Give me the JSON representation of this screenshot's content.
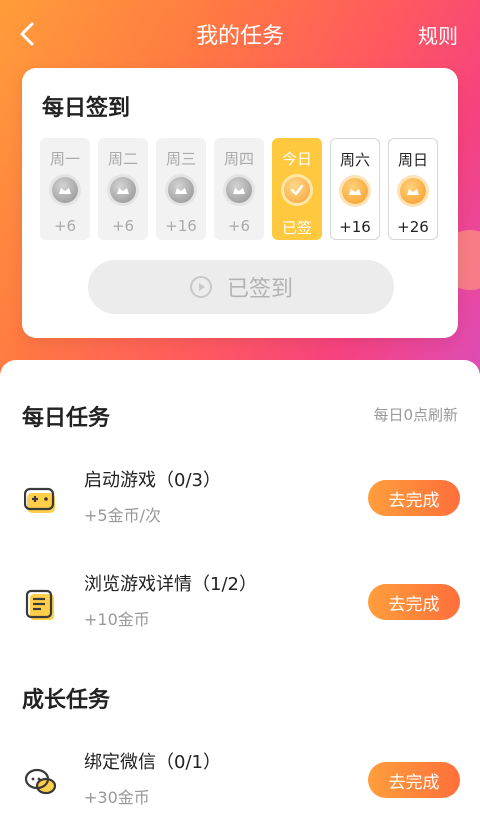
{
  "header": {
    "title": "我的任务",
    "rules_label": "规则"
  },
  "signin": {
    "title": "每日签到",
    "days": [
      {
        "label": "周一",
        "reward": "+6",
        "state": "past"
      },
      {
        "label": "周二",
        "reward": "+6",
        "state": "past"
      },
      {
        "label": "周三",
        "reward": "+16",
        "state": "past"
      },
      {
        "label": "周四",
        "reward": "+6",
        "state": "past"
      },
      {
        "label": "今日",
        "reward": "已签",
        "state": "today"
      },
      {
        "label": "周六",
        "reward": "+16",
        "state": "future"
      },
      {
        "label": "周日",
        "reward": "+26",
        "state": "future"
      }
    ],
    "button_label": "已签到"
  },
  "daily_tasks": {
    "title": "每日任务",
    "refresh_note": "每日0点刷新",
    "items": [
      {
        "name": "启动游戏（0/3）",
        "reward": "+5金币/次",
        "button": "去完成",
        "icon": "gamepad-icon"
      },
      {
        "name": "浏览游戏详情（1/2）",
        "reward": "+10金币",
        "button": "去完成",
        "icon": "document-icon"
      }
    ]
  },
  "growth_tasks": {
    "title": "成长任务",
    "items": [
      {
        "name": "绑定微信（0/1）",
        "reward": "+30金币",
        "button": "去完成",
        "icon": "chat-bubbles-icon"
      }
    ]
  },
  "colors": {
    "accent": "#ff7a3a",
    "today_bg": "#ffc93f",
    "button_gradient_start": "#ff9e3c",
    "button_gradient_end": "#ff6f3a"
  }
}
